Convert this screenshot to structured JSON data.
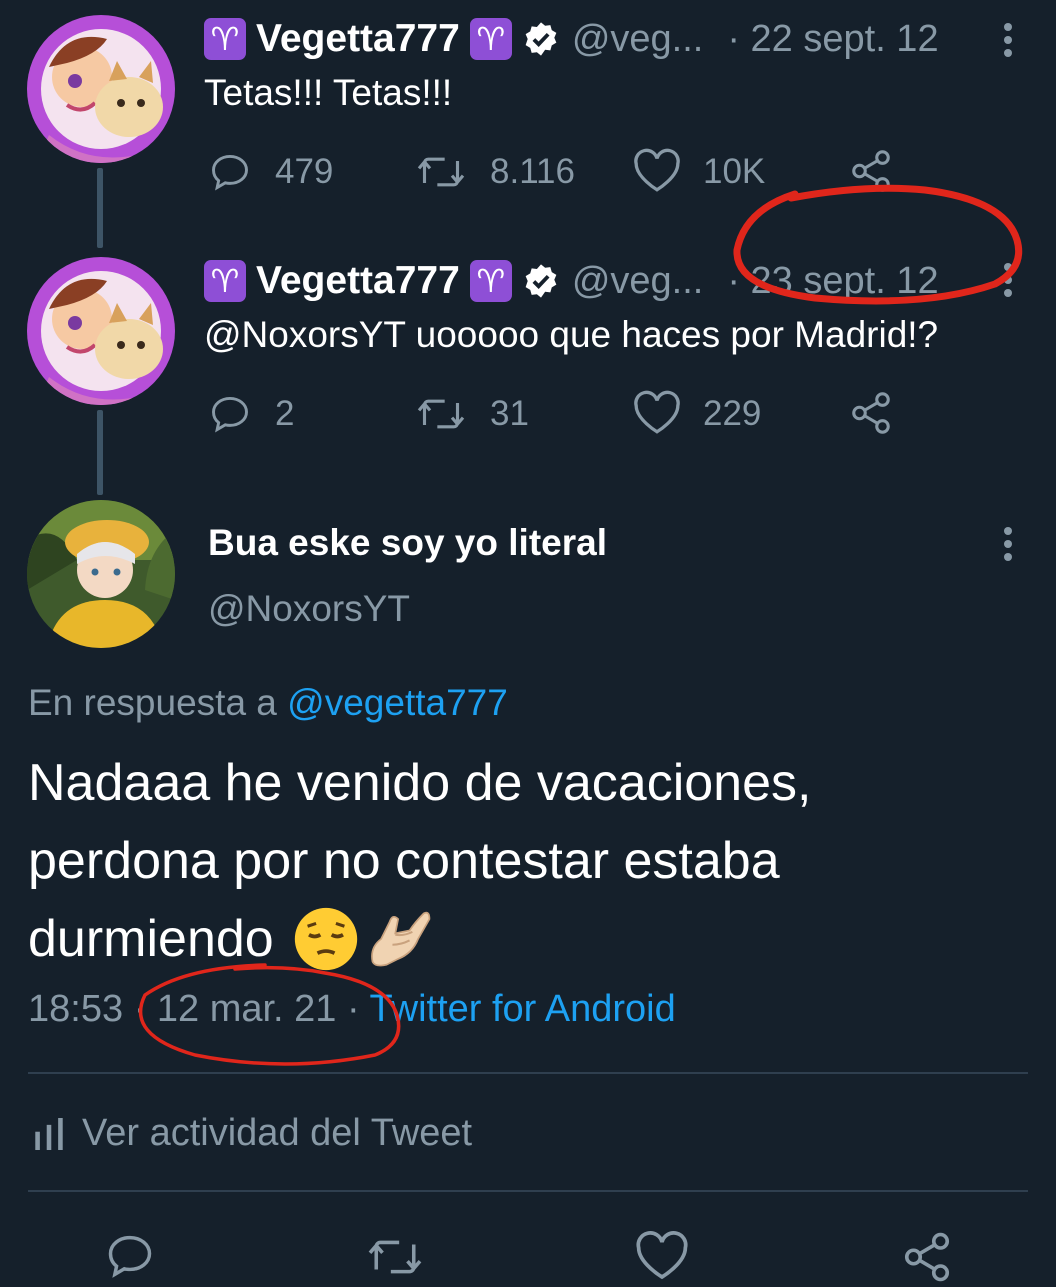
{
  "tweet1": {
    "name": "Vegetta777",
    "handle": "@veg...",
    "date": "· 22 sept. 12",
    "text": "Tetas!!! Tetas!!!",
    "replies": "479",
    "retweets": "8.116",
    "likes": "10K"
  },
  "tweet2": {
    "name": "Vegetta777",
    "handle": "@veg...",
    "date": "· 23 sept. 12",
    "text": "@NoxorsYT uooooo que haces por Madrid!?",
    "replies": "2",
    "retweets": "31",
    "likes": "229"
  },
  "tweet3": {
    "name": "Bua eske soy yo literal",
    "handle": "@NoxorsYT",
    "reply_prefix": "En respuesta a ",
    "reply_to": "@vegetta777",
    "lines": [
      "Nadaaa he venido de vacaciones,",
      "perdona por no contestar estaba",
      "durmiendo"
    ],
    "time": "18:53",
    "date": "· 12 mar. 21 ·",
    "source": "Twitter for Android",
    "activity": "Ver actividad del Tweet"
  },
  "aries_symbol": "♈",
  "colors": {
    "background": "#15202b",
    "secondary_text": "#8899a6",
    "link": "#1da1f2",
    "aries_badge": "#8e4fd6",
    "annotation": "#e0261b"
  }
}
